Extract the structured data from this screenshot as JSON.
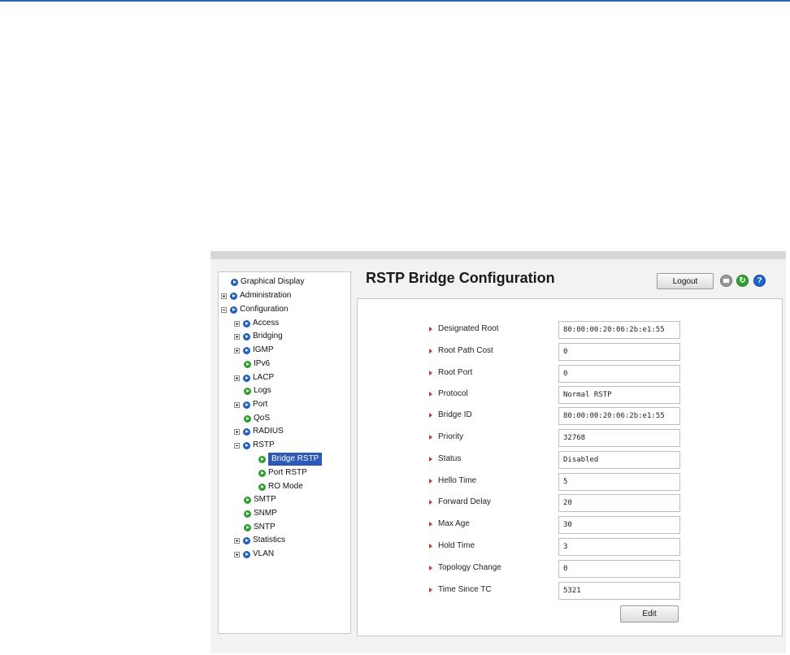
{
  "nav": {
    "items": [
      {
        "label": "Graphical Display",
        "expander": "none",
        "icon": "blue"
      },
      {
        "label": "Administration",
        "expander": "plus",
        "icon": "blue"
      },
      {
        "label": "Configuration",
        "expander": "minus",
        "icon": "blue"
      },
      {
        "label": "Access",
        "expander": "plus",
        "icon": "blue"
      },
      {
        "label": "Bridging",
        "expander": "plus",
        "icon": "blue"
      },
      {
        "label": "IGMP",
        "expander": "plus",
        "icon": "blue"
      },
      {
        "label": "IPv6",
        "expander": "none",
        "icon": "green"
      },
      {
        "label": "LACP",
        "expander": "plus",
        "icon": "blue"
      },
      {
        "label": "Logs",
        "expander": "none",
        "icon": "green"
      },
      {
        "label": "Port",
        "expander": "plus",
        "icon": "blue"
      },
      {
        "label": "QoS",
        "expander": "none",
        "icon": "green"
      },
      {
        "label": "RADIUS",
        "expander": "plus",
        "icon": "blue"
      },
      {
        "label": "RSTP",
        "expander": "minus",
        "icon": "blue"
      },
      {
        "label": "Bridge RSTP",
        "expander": "none",
        "icon": "green",
        "selected": true
      },
      {
        "label": "Port RSTP",
        "expander": "none",
        "icon": "green"
      },
      {
        "label": "RO Mode",
        "expander": "none",
        "icon": "green"
      },
      {
        "label": "SMTP",
        "expander": "none",
        "icon": "green"
      },
      {
        "label": "SNMP",
        "expander": "none",
        "icon": "green"
      },
      {
        "label": "SNTP",
        "expander": "none",
        "icon": "green"
      },
      {
        "label": "Statistics",
        "expander": "plus",
        "icon": "blue"
      },
      {
        "label": "VLAN",
        "expander": "plus",
        "icon": "blue"
      }
    ]
  },
  "header": {
    "title": "RSTP Bridge Configuration",
    "logout_label": "Logout",
    "help_glyph": "?",
    "refresh_glyph": "↻"
  },
  "fields": [
    {
      "label": "Designated Root",
      "value": "80:00:00:20:06:2b:e1:55"
    },
    {
      "label": "Root Path Cost",
      "value": "0"
    },
    {
      "label": "Root Port",
      "value": "0"
    },
    {
      "label": "Protocol",
      "value": "Normal RSTP"
    },
    {
      "label": "Bridge ID",
      "value": "80:00:00:20:06:2b:e1:55"
    },
    {
      "label": "Priority",
      "value": "32768"
    },
    {
      "label": "Status",
      "value": "Disabled"
    },
    {
      "label": "Hello Time",
      "value": "5"
    },
    {
      "label": "Forward Delay",
      "value": "20"
    },
    {
      "label": "Max Age",
      "value": "30"
    },
    {
      "label": "Hold Time",
      "value": "3"
    },
    {
      "label": "Topology Change",
      "value": "0"
    },
    {
      "label": "Time Since TC",
      "value": "5321"
    }
  ],
  "actions": {
    "edit_label": "Edit"
  },
  "colors": {
    "accent": "#2d59b6",
    "arrow": "#c0392b",
    "rule": "#2f63b4"
  }
}
